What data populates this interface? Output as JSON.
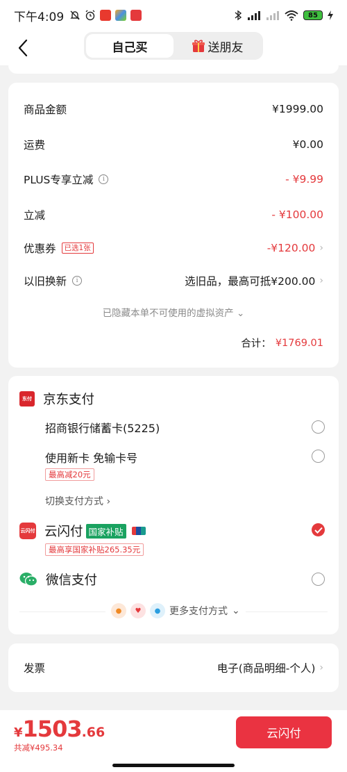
{
  "status_bar": {
    "time": "下午4:09",
    "battery": "85",
    "hd_label": "HD"
  },
  "nav": {
    "tabs": [
      {
        "label": "自己买",
        "active": true
      },
      {
        "label": "送朋友",
        "active": false
      }
    ]
  },
  "summary": {
    "rows": [
      {
        "label": "商品金额",
        "value": "¥1999.00"
      },
      {
        "label": "运费",
        "value": "¥0.00"
      },
      {
        "label": "PLUS专享立减",
        "value": "- ¥9.99"
      },
      {
        "label": "立减",
        "value": "- ¥100.00"
      },
      {
        "label": "优惠券",
        "tag": "已选1张",
        "value": "-¥120.00"
      },
      {
        "label": "以旧换新",
        "value": "选旧品，最高可抵¥200.00"
      }
    ],
    "hidden_note": "已隐藏本单不可使用的虚拟资产",
    "total_label": "合计：",
    "total_value": "¥1769.01"
  },
  "payment": {
    "jd_pay": {
      "title": "京东支付",
      "logo_text": "东付",
      "options": [
        {
          "label": "招商银行储蓄卡(5225)"
        },
        {
          "label": "使用新卡 免输卡号",
          "promo": "最高减20元"
        }
      ],
      "switch_link": "切换支付方式"
    },
    "union_pay": {
      "title": "云闪付",
      "logo_text": "云闪付",
      "tag": "国家补贴",
      "promo": "最高享国家补贴265.35元"
    },
    "wechat": {
      "title": "微信支付"
    },
    "more": "更多支付方式"
  },
  "invoice": {
    "label": "发票",
    "value": "电子(商品明细-个人)"
  },
  "bottom": {
    "currency": "¥",
    "price_int": "1503",
    "price_dec": ".66",
    "saved": "共减¥495.34",
    "button": "云闪付"
  },
  "colors": {
    "accent": "#e4393c",
    "green": "#1aa260",
    "wechat": "#2aae67"
  }
}
